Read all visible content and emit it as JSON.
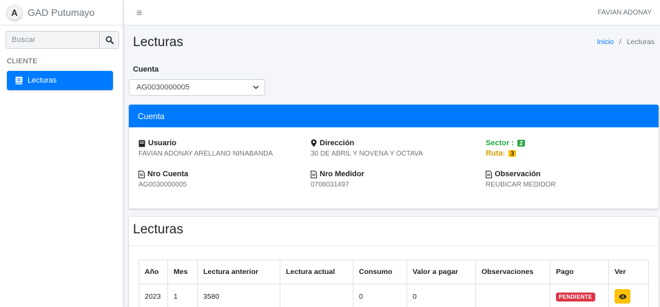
{
  "brand": {
    "initial": "A",
    "name": "GAD Putumayo"
  },
  "sidebar": {
    "search_placeholder": "Buscar",
    "section": "CLIENTE",
    "items": [
      {
        "label": "Lecturas",
        "icon": "book-icon",
        "active": true
      }
    ]
  },
  "topbar": {
    "menu_icon": "≡",
    "user": "FAVIAN ADONAY"
  },
  "page": {
    "title": "Lecturas",
    "breadcrumb": {
      "home": "Inicio",
      "separator": "/",
      "current": "Lecturas"
    }
  },
  "account_select": {
    "label": "Cuenta",
    "value": "AG0030000005"
  },
  "account_card": {
    "header": "Cuenta",
    "usuario": {
      "label": "Usuario",
      "value": "FAVIAN ADONAY ARELLANO NINABANDA"
    },
    "direccion": {
      "label": "Dirección",
      "value": "30 DE ABRIL Y NOVENA Y OCTAVA"
    },
    "sector": {
      "label": "Sector",
      "value": "2"
    },
    "ruta": {
      "label": "Ruta",
      "value": "3"
    },
    "nro_cuenta": {
      "label": "Nro Cuenta",
      "value": "AG0030000005"
    },
    "nro_medidor": {
      "label": "Nro Medidor",
      "value": "0708031497"
    },
    "observacion": {
      "label": "Observación",
      "value": "REUBICAR MEDIDOR"
    }
  },
  "readings": {
    "title": "Lecturas",
    "columns": [
      "Año",
      "Mes",
      "Lectura anterior",
      "Lectura actual",
      "Consumo",
      "Valor a pagar",
      "Observaciones",
      "Pago",
      "Ver"
    ],
    "rows": [
      {
        "anio": "2023",
        "mes": "1",
        "lectura_anterior": "3580",
        "lectura_actual": "",
        "consumo": "0",
        "valor": "0",
        "observaciones": "",
        "pago": "PENDIENTE"
      }
    ]
  },
  "colors": {
    "primary": "#007bff",
    "success": "#28a745",
    "warning": "#ffc107",
    "danger": "#dc3545"
  }
}
